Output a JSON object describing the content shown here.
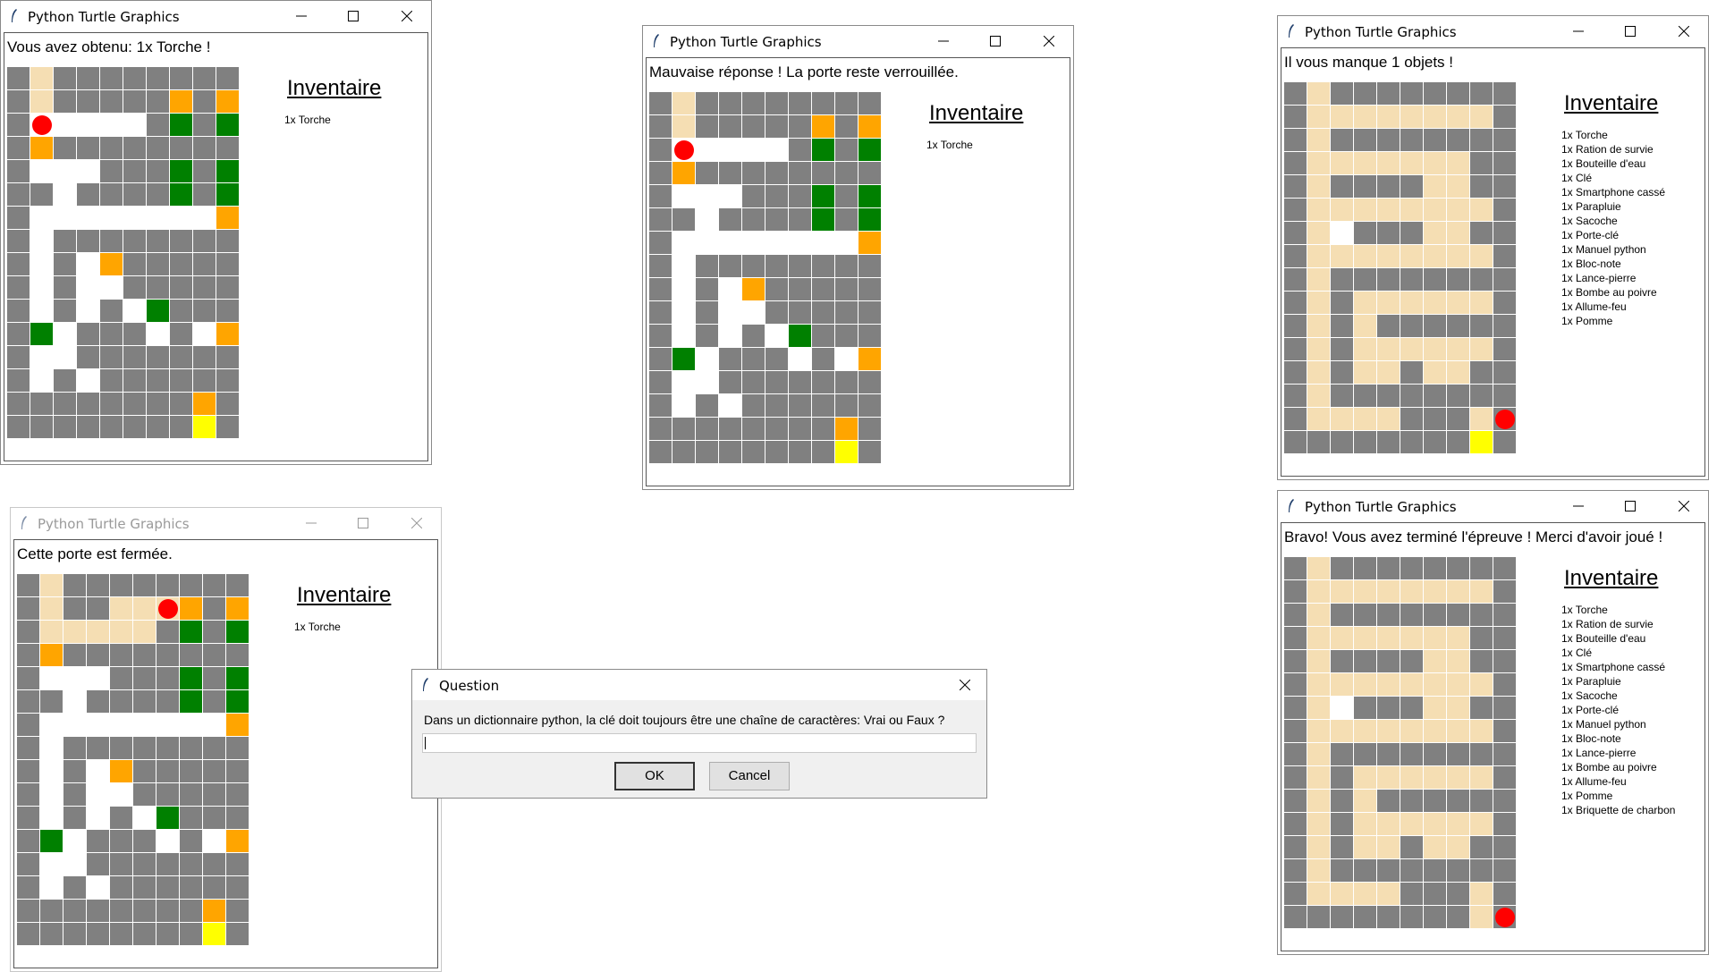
{
  "windows": [
    {
      "id": "w1",
      "title": "Python Turtle Graphics",
      "message": "Vous avez obtenu: 1x Torche !",
      "inventory_title": "Inventaire",
      "inventory": [
        "1x Torche"
      ],
      "active": true,
      "player": {
        "row": 2,
        "col": 1
      },
      "maze": [
        "1211111111",
        "1211111414",
        "1000001313",
        "1411111111",
        "1000111313",
        "1101111313",
        "1000000004",
        "1011111111",
        "1010411111",
        "1010011111",
        "1010103111",
        "1301110104",
        "1001111111",
        "1010111111",
        "1111111141",
        "1111111151"
      ]
    },
    {
      "id": "w2",
      "title": "Python Turtle Graphics",
      "message": "Mauvaise réponse ! La porte reste verrouillée.",
      "inventory_title": "Inventaire",
      "inventory": [
        "1x Torche"
      ],
      "active": true,
      "player": {
        "row": 2,
        "col": 1
      },
      "maze": [
        "1211111111",
        "1211111414",
        "1000001313",
        "1411111111",
        "1000111313",
        "1101111313",
        "1000000004",
        "1011111111",
        "1010411111",
        "1010011111",
        "1010103111",
        "1301110104",
        "1001111111",
        "1010111111",
        "1111111141",
        "1111111151"
      ]
    },
    {
      "id": "w3",
      "title": "Python Turtle Graphics",
      "message": "Il vous manque 1 objets !",
      "inventory_title": "Inventaire",
      "inventory": [
        "1x Torche",
        "1x Ration de survie",
        "1x Bouteille d'eau",
        "1x Clé",
        "1x Smartphone cassé",
        "1x Parapluie",
        "1x Sacoche",
        "1x Porte-clé",
        "1x Manuel python",
        "1x Bloc-note",
        "1x Lance-pierre",
        "1x Bombe au poivre",
        "1x Allume-feu",
        "1x Pomme"
      ],
      "active": true,
      "player": {
        "row": 14,
        "col": 9
      },
      "maze": [
        "1211111111",
        "1222222221",
        "1211111111",
        "1222222211",
        "1211112211",
        "1222222221",
        "1201112211",
        "1222222221",
        "1211111111",
        "1212222221",
        "1212111111",
        "1212222221",
        "1212212211",
        "1211111111",
        "1222211121",
        "1111111151"
      ]
    },
    {
      "id": "w4",
      "title": "Python Turtle Graphics",
      "message": "Cette porte est fermée.",
      "inventory_title": "Inventaire",
      "inventory": [
        "1x Torche"
      ],
      "active": false,
      "player": {
        "row": 1,
        "col": 6
      },
      "maze": [
        "1211111111",
        "1211222414",
        "1222221313",
        "1411111111",
        "1000111313",
        "1101111313",
        "1000000004",
        "1011111111",
        "1010411111",
        "1010011111",
        "1010103111",
        "1301110104",
        "1001111111",
        "1010111111",
        "1111111141",
        "1111111151"
      ]
    },
    {
      "id": "w5",
      "title": "Python Turtle Graphics",
      "message": "Bravo! Vous avez terminé l'épreuve ! Merci d'avoir joué !",
      "inventory_title": "Inventaire",
      "inventory": [
        "1x Torche",
        "1x Ration de survie",
        "1x Bouteille d'eau",
        "1x Clé",
        "1x Smartphone cassé",
        "1x Parapluie",
        "1x Sacoche",
        "1x Porte-clé",
        "1x Manuel python",
        "1x Bloc-note",
        "1x Lance-pierre",
        "1x Bombe au poivre",
        "1x Allume-feu",
        "1x Pomme",
        "1x Briquette de charbon"
      ],
      "active": true,
      "player": {
        "row": 15,
        "col": 9
      },
      "maze": [
        "1211111111",
        "1222222221",
        "1211111111",
        "1222222211",
        "1211112211",
        "1222222221",
        "1201112211",
        "1222222221",
        "1211111111",
        "1212222221",
        "1212111111",
        "1212222221",
        "1212212211",
        "1211111111",
        "1222211121",
        "1111111121"
      ]
    }
  ],
  "dialog": {
    "title": "Question",
    "question": "Dans un dictionnaire python, la clé doit toujours être une chaîne de caractères: Vrai ou Faux ?",
    "input_value": "",
    "ok_label": "OK",
    "cancel_label": "Cancel"
  },
  "colors": {
    "floor": "#ffffff",
    "wall": "#808080",
    "lit_floor": "#f5deb3",
    "object": "#008000",
    "door": "#ffa500",
    "exit": "#ffff00",
    "player": "#ff0000"
  }
}
